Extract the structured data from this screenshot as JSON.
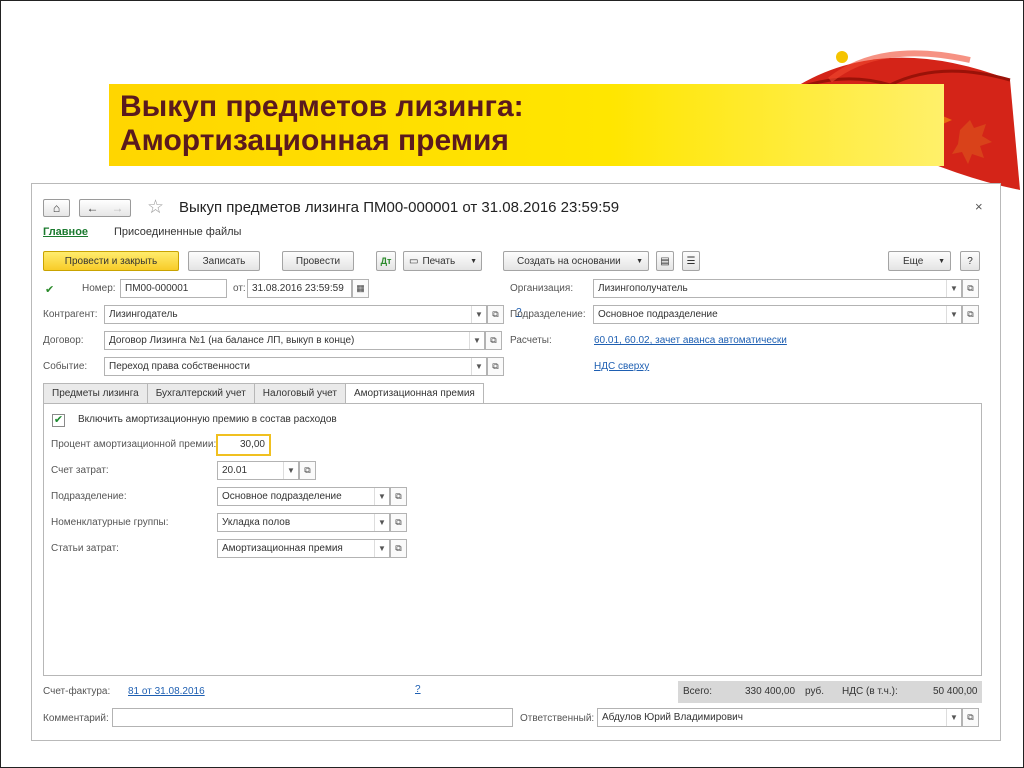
{
  "slide": {
    "title_line1": "Выкуп предметов лизинга:",
    "title_line2": "Амортизационная премия"
  },
  "window": {
    "title": "Выкуп предметов лизинга ПМ00-000001 от 31.08.2016 23:59:59",
    "close": "×",
    "links": {
      "main": "Главное",
      "files": "Присоединенные файлы"
    }
  },
  "toolbar": {
    "post_close": "Провести и закрыть",
    "save": "Записать",
    "post": "Провести",
    "print": "Печать",
    "create_based": "Создать на основании",
    "more": "Еще",
    "help": "?"
  },
  "header": {
    "number_label": "Номер:",
    "number_value": "ПМ00-000001",
    "date_label": "от:",
    "date_value": "31.08.2016 23:59:59",
    "org_label": "Организация:",
    "org_value": "Лизингополучатель",
    "counterparty_label": "Контрагент:",
    "counterparty_value": "Лизингодатель",
    "department_label": "Подразделение:",
    "department_value": "Основное подразделение",
    "contract_label": "Договор:",
    "contract_value": "Договор Лизинга №1 (на балансе ЛП, выкуп в конце)",
    "settlements_label": "Расчеты:",
    "settlements_value": "60.01, 60.02, зачет аванса автоматически",
    "event_label": "Событие:",
    "event_value": "Переход права собственности",
    "vat_link": "НДС сверху",
    "help_q": "?"
  },
  "tabs": [
    "Предметы лизинга",
    "Бухгалтерский учет",
    "Налоговый учет",
    "Амортизационная премия"
  ],
  "bonus": {
    "include_label": "Включить амортизационную премию в состав расходов",
    "include_checked": true,
    "percent_label": "Процент амортизационной премии:",
    "percent_value": "30,00",
    "account_label": "Счет затрат:",
    "account_value": "20.01",
    "department_label": "Подразделение:",
    "department_value": "Основное подразделение",
    "nomenclature_label": "Номенклатурные группы:",
    "nomenclature_value": "Укладка полов",
    "cost_items_label": "Статьи затрат:",
    "cost_items_value": "Амортизационная премия"
  },
  "footer": {
    "invoice_label": "Счет-фактура:",
    "invoice_value": "81 от 31.08.2016",
    "help_q": "?",
    "total_label": "Всего:",
    "total_value": "330 400,00",
    "currency": "руб.",
    "vat_label": "НДС (в т.ч.):",
    "vat_value": "50 400,00",
    "comment_label": "Комментарий:",
    "responsible_label": "Ответственный:",
    "responsible_value": "Абдулов Юрий Владимирович"
  }
}
